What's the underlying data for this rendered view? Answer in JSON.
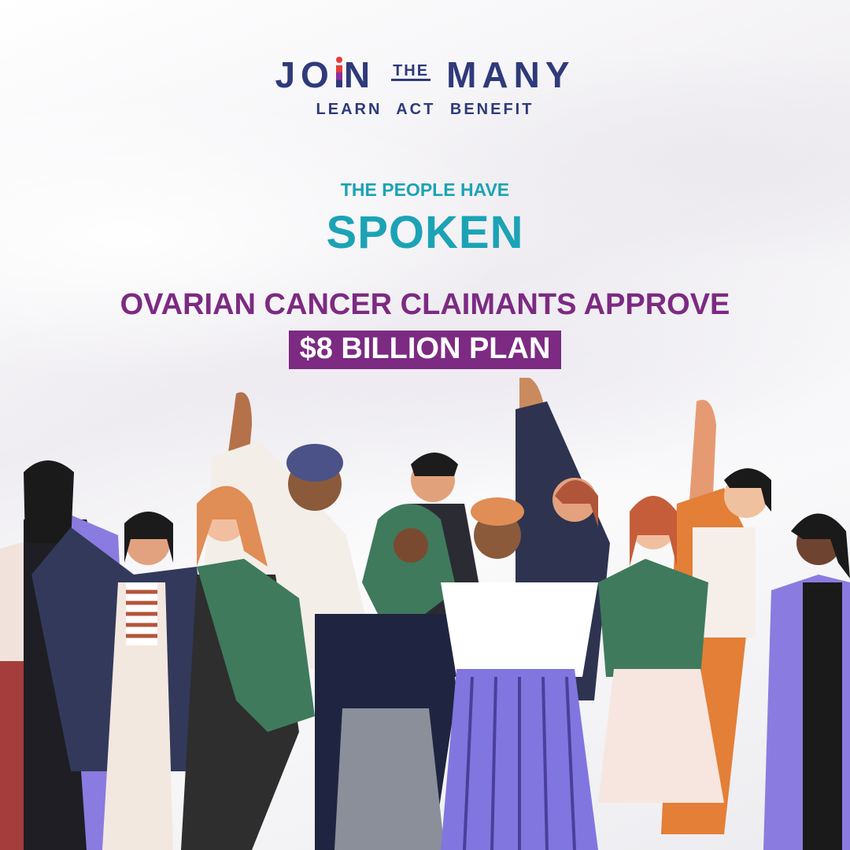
{
  "logo": {
    "word_join_a": "JO",
    "word_join_b": "N",
    "word_the": "THE",
    "word_many": "MANY",
    "tagline": "LEARN ACT BENEFIT"
  },
  "kicker": "THE PEOPLE HAVE",
  "headline": "SPOKEN",
  "subheadline": "OVARIAN CANCER CLAIMANTS APPROVE",
  "highlight": "$8 BILLION PLAN",
  "colors": {
    "brand_navy": "#2f3a7a",
    "teal": "#1ba3b5",
    "purple": "#7c2a82",
    "logo_accent_red": "#e63b3b"
  },
  "illustration": "crowd-of-women-illustration"
}
